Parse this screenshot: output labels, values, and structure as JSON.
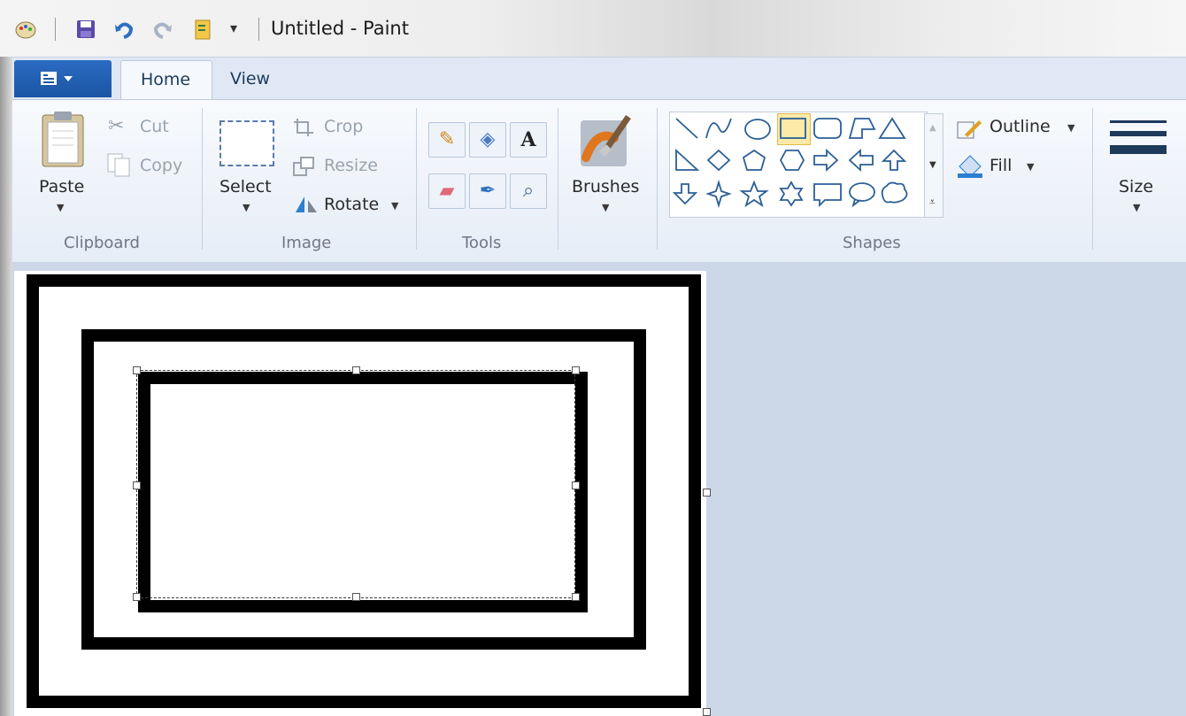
{
  "window": {
    "title": "Untitled - Paint"
  },
  "quick_access": {
    "customize_glyph": "▾"
  },
  "tabs": {
    "home": "Home",
    "view": "View"
  },
  "clipboard": {
    "paste": "Paste",
    "cut": "Cut",
    "copy": "Copy",
    "group": "Clipboard"
  },
  "image": {
    "select": "Select",
    "crop": "Crop",
    "resize": "Resize",
    "rotate": "Rotate",
    "group": "Image"
  },
  "tools": {
    "group": "Tools"
  },
  "brushes": {
    "label": "Brushes"
  },
  "shapes": {
    "outline": "Outline",
    "fill": "Fill",
    "group": "Shapes"
  },
  "size": {
    "label": "Size"
  },
  "colors": {
    "accent": "#1c55a3",
    "selected_shape": "#f5c542",
    "icon": "#2b5f96"
  },
  "icons": [
    "paint-app-icon",
    "save-icon",
    "undo-icon",
    "redo-icon",
    "properties-icon",
    "paste-icon",
    "cut-icon",
    "copy-icon",
    "crop-icon",
    "resize-icon",
    "rotate-icon",
    "pencil-icon",
    "fill-bucket-icon",
    "text-icon",
    "eraser-icon",
    "color-picker-icon",
    "magnifier-icon",
    "brush-icon",
    "outline-icon",
    "fill-icon",
    "size-lines-icon"
  ]
}
